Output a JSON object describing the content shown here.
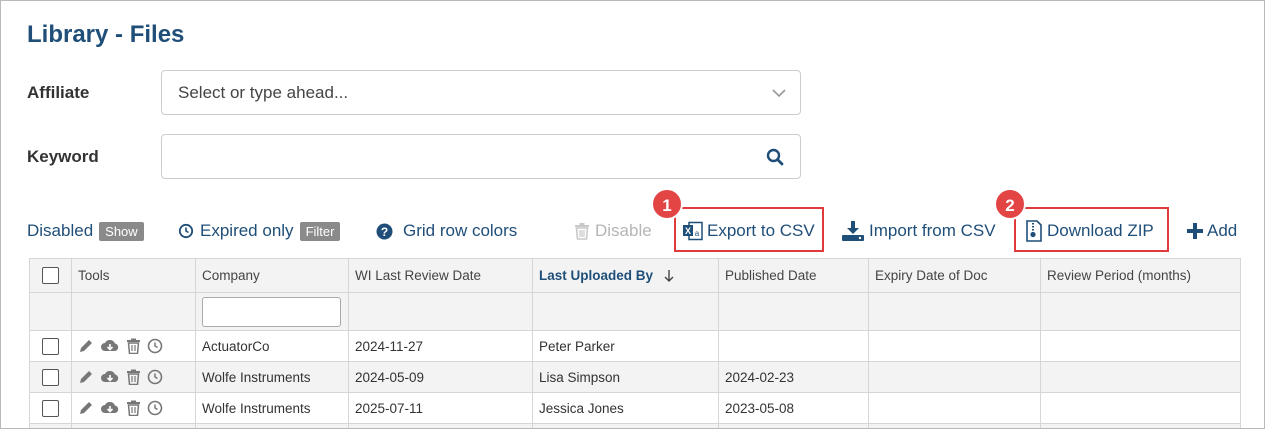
{
  "page": {
    "title": "Library - Files"
  },
  "filters": {
    "affiliate_label": "Affiliate",
    "affiliate_placeholder": "Select or type ahead...",
    "keyword_label": "Keyword",
    "keyword_value": ""
  },
  "toolbar": {
    "disabled_label": "Disabled",
    "disabled_toggle": "Show",
    "expired_label": "Expired only",
    "expired_toggle": "Filter",
    "grid_row_colors": "Grid row colors",
    "disable": "Disable",
    "export_csv": "Export to CSV",
    "import_csv": "Import from CSV",
    "download_zip": "Download ZIP",
    "add": "Add"
  },
  "annotations": {
    "badge1": "1",
    "badge2": "2",
    "highlight_color": "#e03a3a"
  },
  "grid": {
    "columns": [
      "Tools",
      "Company",
      "WI Last Review Date",
      "Last Uploaded By",
      "Published Date",
      "Expiry Date of Doc",
      "Review Period (months)"
    ],
    "sorted_column": "Last Uploaded By",
    "rows": [
      {
        "company": "ActuatorCo",
        "wi_last_review": "2024-11-27",
        "uploaded_by": "Peter Parker",
        "published": "",
        "expiry": "",
        "review_period": ""
      },
      {
        "company": "Wolfe Instruments",
        "wi_last_review": "2024-05-09",
        "uploaded_by": "Lisa Simpson",
        "published": "2024-02-23",
        "expiry": "",
        "review_period": ""
      },
      {
        "company": "Wolfe Instruments",
        "wi_last_review": "2025-07-11",
        "uploaded_by": "Jessica Jones",
        "published": "2023-05-08",
        "expiry": "",
        "review_period": ""
      }
    ]
  },
  "colors": {
    "primary": "#1f4e79",
    "accent_red": "#e34545",
    "pill_gray": "#8a8a8a"
  },
  "icons": [
    "chevron-down-icon",
    "search-icon",
    "clock-icon",
    "question-circle-icon",
    "trash-icon",
    "excel-icon",
    "download-tray-icon",
    "zip-file-icon",
    "plus-icon",
    "pencil-icon",
    "cloud-download-icon",
    "sort-down-arrow-icon"
  ]
}
